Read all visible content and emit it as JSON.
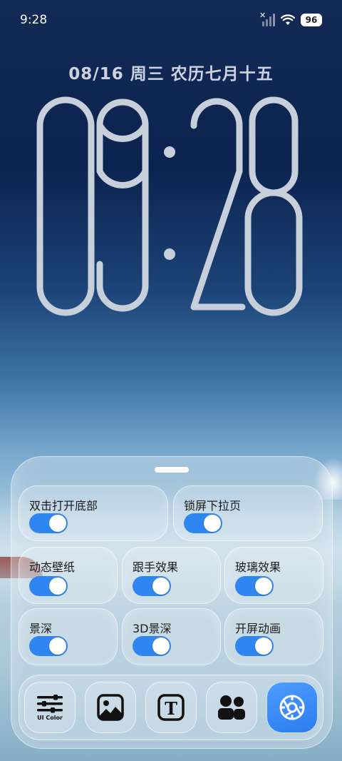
{
  "status_bar": {
    "time": "9:28",
    "battery": "96",
    "icons": [
      "no-signal-icon",
      "wifi-icon",
      "battery-icon"
    ]
  },
  "lockscreen": {
    "date": "08/16 周三 农历七月十五",
    "clock": "09:28"
  },
  "panel": {
    "tiles": [
      {
        "label": "双击打开底部",
        "on": true
      },
      {
        "label": "锁屏下拉页",
        "on": true
      },
      {
        "label": "动态壁纸",
        "on": true
      },
      {
        "label": "跟手效果",
        "on": true
      },
      {
        "label": "玻璃效果",
        "on": true
      },
      {
        "label": "景深",
        "on": true
      },
      {
        "label": "3D景深",
        "on": true
      },
      {
        "label": "开屏动画",
        "on": true
      }
    ],
    "dock": [
      {
        "icon": "sliders-icon",
        "caption": "UI Color"
      },
      {
        "icon": "image-icon"
      },
      {
        "icon": "text-icon"
      },
      {
        "icon": "people-icon"
      },
      {
        "icon": "settings-gear-icon",
        "active": true
      }
    ]
  },
  "colors": {
    "toggle_on": "#2f86f0",
    "active_button": "#3a8cf5"
  }
}
